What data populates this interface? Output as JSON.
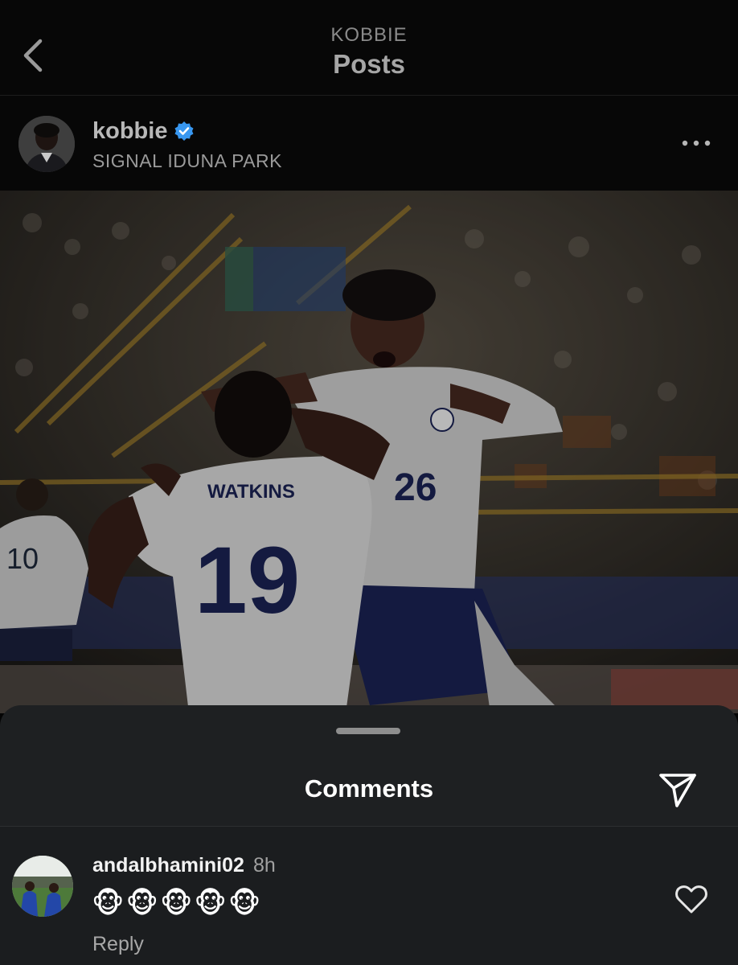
{
  "header": {
    "account": "KOBBIE",
    "title": "Posts"
  },
  "post": {
    "username": "kobbie",
    "verified": true,
    "location": "SIGNAL IDUNA PARK",
    "photo": {
      "description_icon": "photo-image",
      "jersey_left_name": "WATKINS",
      "jersey_left_number": "19",
      "jersey_right_number": "26",
      "jersey_background_number": "10"
    }
  },
  "comments_sheet": {
    "title": "Comments",
    "items": [
      {
        "username": "andalbhamini02",
        "time": "8h",
        "text": "🐵🐵🐵🐵🐵",
        "reply_label": "Reply"
      }
    ]
  },
  "colors": {
    "background": "#050505",
    "sheet": "#1e2022",
    "verified_badge": "#3897f0",
    "text_primary": "#ffffff",
    "text_secondary": "#a0a0a0"
  },
  "icons": {
    "back": "chevron-left-icon",
    "more": "more-horizontal-icon",
    "verified": "verified-badge-icon",
    "share": "send-icon",
    "like": "heart-outline-icon"
  }
}
